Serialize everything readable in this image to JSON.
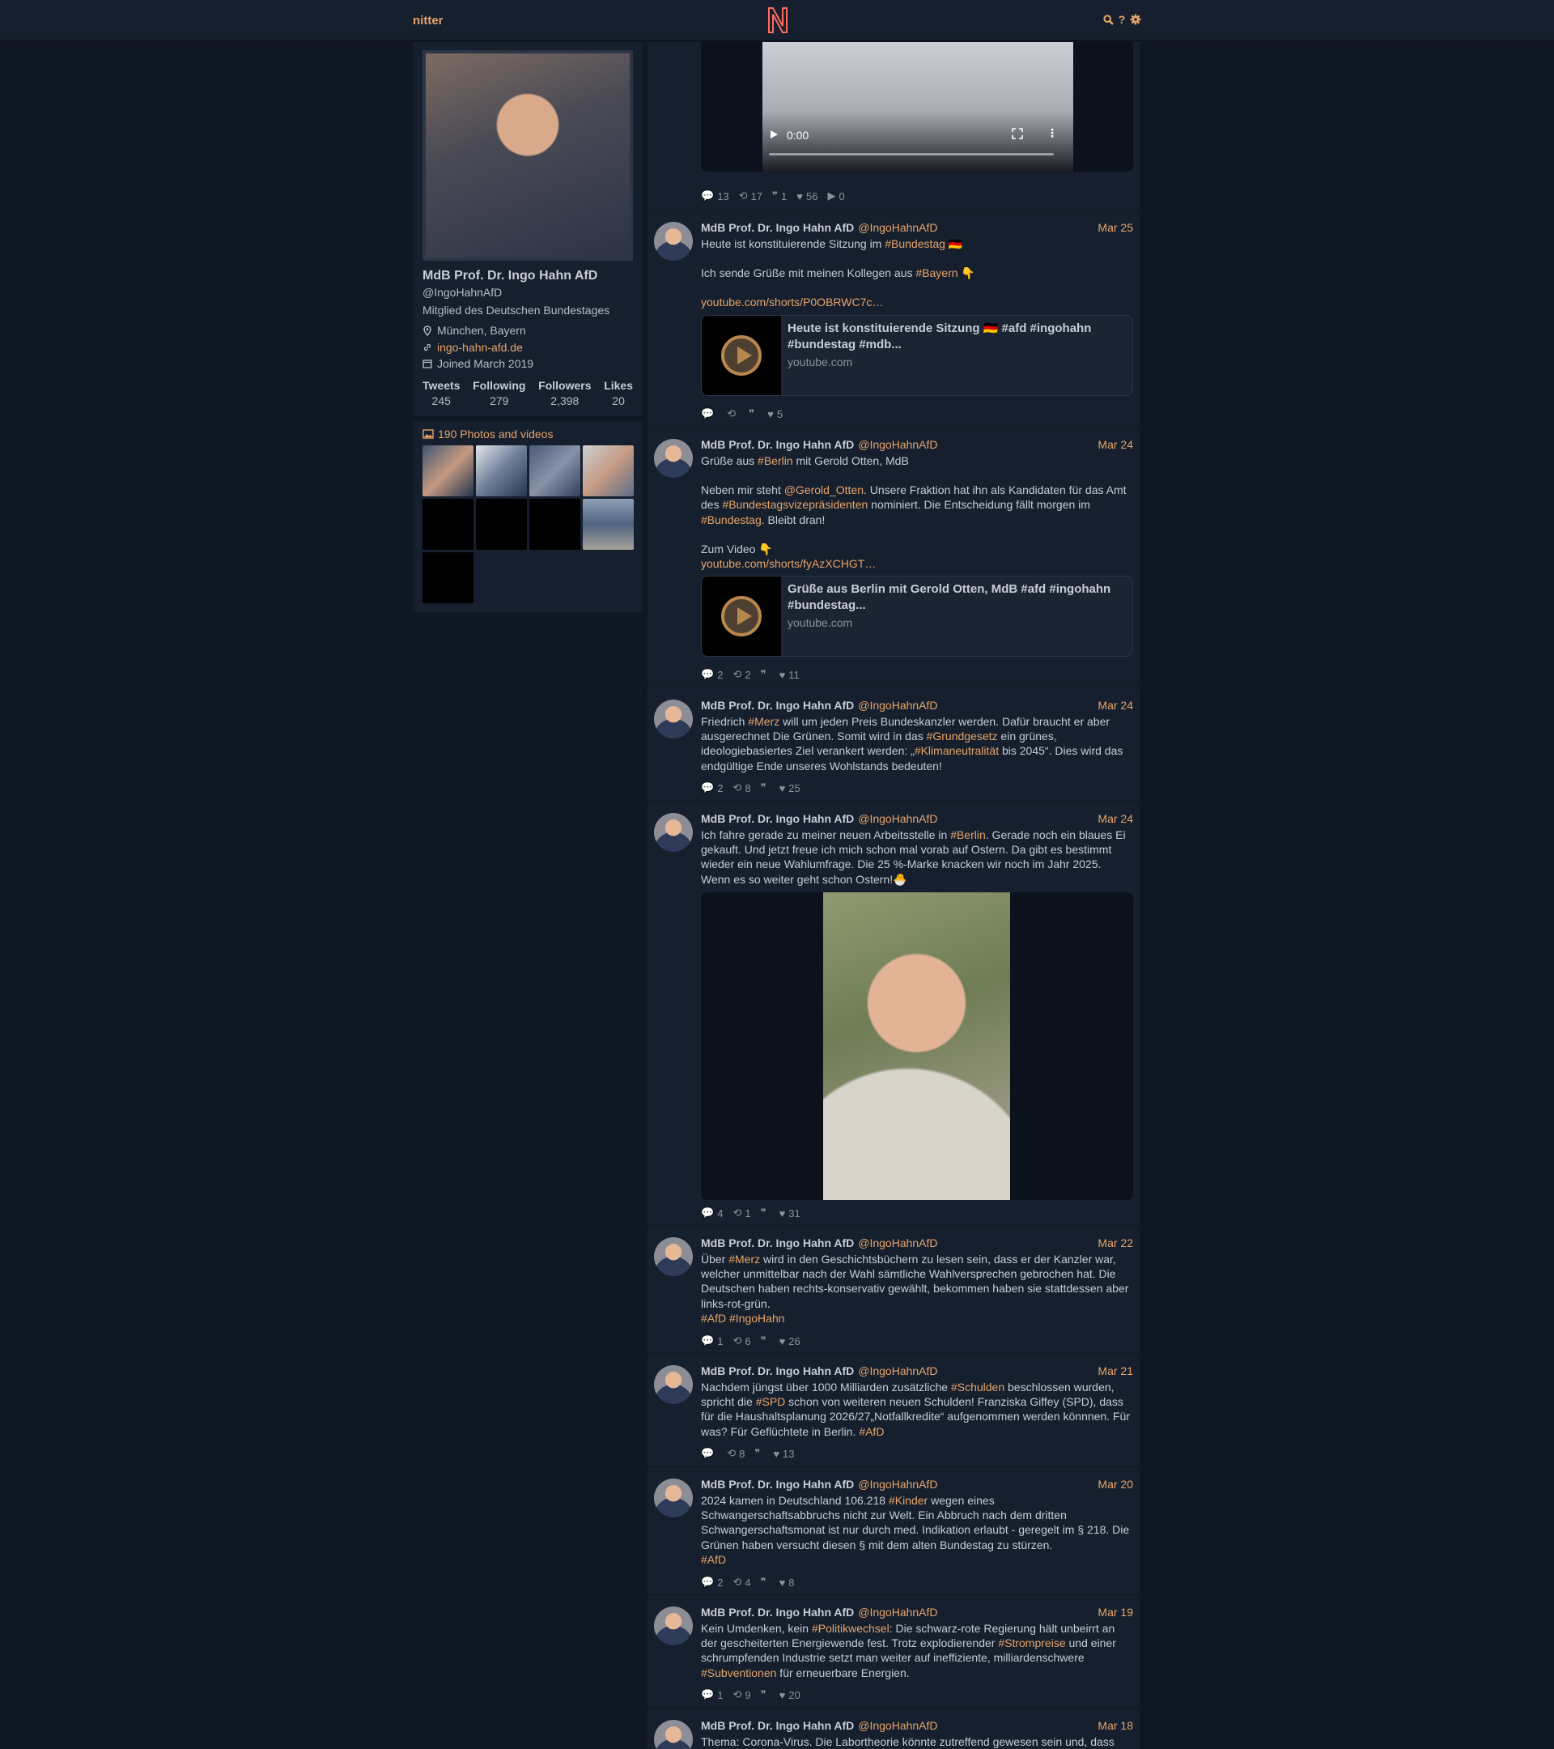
{
  "navbar": {
    "brand": "nitter",
    "logo": "N",
    "icons": [
      "search-icon",
      "help-icon",
      "gear-icon"
    ]
  },
  "profile": {
    "name": "MdB Prof. Dr. Ingo Hahn AfD",
    "handle": "@IngoHahnAfD",
    "bio": "Mitglied des Deutschen Bundestages",
    "location": "München, Bayern",
    "website": "ingo-hahn-afd.de",
    "joined": "Joined March 2019",
    "stats": [
      {
        "label": "Tweets",
        "value": "245"
      },
      {
        "label": "Following",
        "value": "279"
      },
      {
        "label": "Followers",
        "value": "2,398"
      },
      {
        "label": "Likes",
        "value": "20"
      }
    ]
  },
  "photo_rail": {
    "header": "190 Photos and videos"
  },
  "timeline": {
    "author": {
      "fullname": "MdB Prof. Dr. Ingo Hahn AfD",
      "username": "@IngoHahnAfD"
    },
    "video_time": "0:00",
    "top_stats": {
      "replies": "13",
      "retweets": "17",
      "quotes": "1",
      "likes": "56",
      "plays": "0"
    },
    "tweets": [
      {
        "date": "Mar 25",
        "line1a": "Heute ist konstituierende Sitzung im ",
        "line1b": "#Bundestag",
        "line1c": " 🇩🇪",
        "line2a": "Ich sende Grüße mit meinen Kollegen aus ",
        "line2b": "#Bayern",
        "line2c": " 👇",
        "link": "youtube.com/shorts/P0OBRWC7c…",
        "card_title": "Heute ist konstituierende Sitzung 🇩🇪 #afd #ingohahn #bundestag #mdb...",
        "card_domain": "youtube.com",
        "stats": {
          "replies": "",
          "retweets": "",
          "quotes": "",
          "likes": "5"
        }
      },
      {
        "date": "Mar 24",
        "p1a": "Grüße aus ",
        "p1b": "#Berlin",
        "p1c": " mit Gerold Otten, MdB",
        "p2a": "Neben mir steht ",
        "p2b": "@Gerold_Otten",
        "p2c": ". Unsere Fraktion hat ihn als Kandidaten für das Amt des ",
        "p2d": "#Bundestagsvizepräsidenten",
        "p2e": " nominiert. Die Entscheidung fällt morgen im ",
        "p2f": "#Bundestag",
        "p2g": ". Bleibt dran!",
        "p3": "Zum Video 👇",
        "link": "youtube.com/shorts/fyAzXCHGT…",
        "card_title": "Grüße aus Berlin mit Gerold Otten, MdB #afd #ingohahn #bundestag...",
        "card_domain": "youtube.com",
        "stats": {
          "replies": "2",
          "retweets": "2",
          "quotes": "",
          "likes": "11"
        }
      },
      {
        "date": "Mar 24",
        "a": "Friedrich ",
        "b": "#Merz",
        "c": " will um jeden Preis Bundeskanzler werden. Dafür braucht er aber ausgerechnet Die Grünen. Somit wird in das ",
        "d": "#Grundgesetz",
        "e": " ein grünes, ideologiebasiertes Ziel verankert werden: „",
        "f": "#Klimaneutralität",
        "g": " bis 2045“. Dies wird das endgültige Ende unseres Wohlstands bedeuten!",
        "stats": {
          "replies": "2",
          "retweets": "8",
          "quotes": "",
          "likes": "25"
        }
      },
      {
        "date": "Mar 24",
        "a": "Ich fahre gerade zu meiner neuen Arbeitsstelle in ",
        "b": "#Berlin",
        "c": ". Gerade noch ein blaues Ei gekauft. Und jetzt freue ich mich schon mal vorab auf Ostern. Da gibt es bestimmt wieder ein neue Wahlumfrage. Die 25 %-Marke knacken wir noch im Jahr 2025. Wenn es so weiter geht schon Ostern!🐣",
        "stats": {
          "replies": "4",
          "retweets": "1",
          "quotes": "",
          "likes": "31"
        }
      },
      {
        "date": "Mar 22",
        "a": "Über ",
        "b": "#Merz",
        "c": " wird in den Geschichtsbüchern zu lesen sein, dass er der Kanzler war, welcher unmittelbar nach der Wahl sämtliche Wahlversprechen gebrochen hat. Die Deutschen haben rechts-konservativ gewählt, bekommen haben sie stattdessen aber links-rot-grün.",
        "tags": "#AfD #IngoHahn",
        "stats": {
          "replies": "1",
          "retweets": "6",
          "quotes": "",
          "likes": "26"
        }
      },
      {
        "date": "Mar 21",
        "a": "Nachdem jüngst über 1000 Milliarden zusätzliche ",
        "b": "#Schulden",
        "c": " beschlossen wurden, spricht die ",
        "d": "#SPD",
        "e": " schon von weiteren neuen Schulden! Franziska Giffey (SPD), dass für die Haushaltsplanung 2026/27„Notfallkredite“ aufgenommen werden könnnen. Für was? Für Geflüchtete in Berlin. ",
        "f": "#AfD",
        "stats": {
          "replies": "",
          "retweets": "8",
          "quotes": "",
          "likes": "13"
        }
      },
      {
        "date": "Mar 20",
        "a": "2024 kamen in Deutschland 106.218 ",
        "b": "#Kinder",
        "c": " wegen eines Schwangerschaftsabbruchs nicht zur Welt. Ein Abbruch nach dem dritten Schwangerschaftsmonat ist nur durch med. Indikation erlaubt - geregelt im § 218. Die Grünen haben versucht diesen § mit dem alten Bundestag zu stürzen.",
        "tags": "#AfD",
        "stats": {
          "replies": "2",
          "retweets": "4",
          "quotes": "",
          "likes": "8"
        }
      },
      {
        "date": "Mar 19",
        "a": "Kein Umdenken, kein ",
        "b": "#Politikwechsel",
        "c": ": Die schwarz-rote Regierung hält unbeirrt an der gescheiterten Energiewende fest. Trotz explodierender ",
        "d": "#Strompreise",
        "e": " und einer schrumpfenden Industrie setzt man weiter auf ineffiziente, milliardenschwere ",
        "f": "#Subventionen",
        "g": " für erneuerbare Energien.",
        "stats": {
          "replies": "1",
          "retweets": "9",
          "quotes": "",
          "likes": "20"
        }
      },
      {
        "date": "Mar 18",
        "a": "Thema: Corona-Virus. Die Labortheorie könnte zutreffend gewesen sein und, dass"
      }
    ]
  }
}
